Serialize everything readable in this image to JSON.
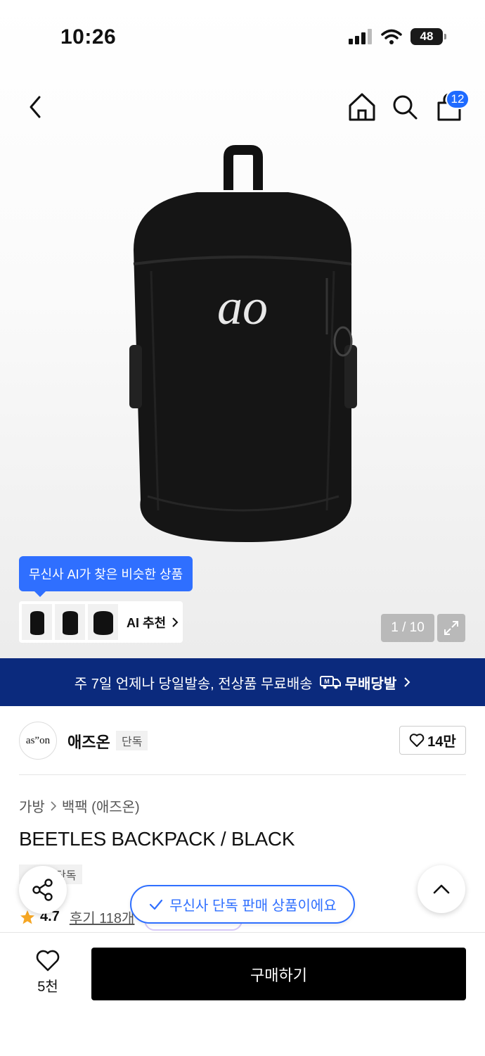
{
  "status_bar": {
    "time": "10:26",
    "battery": "48"
  },
  "nav": {
    "cart_count": "12"
  },
  "gallery": {
    "ai_tooltip": "무신사 AI가 찾은 비슷한 상품",
    "ai_label": "AI 추천",
    "counter": "1 / 10"
  },
  "banner": {
    "text": "주 7일 언제나 당일발송, 전상품 무료배송",
    "brand": "무배당발"
  },
  "brand": {
    "logo_text": "as”on",
    "name": "애즈온",
    "tag": "단독",
    "likes": "14만"
  },
  "product": {
    "breadcrumb": [
      "가방",
      "백팩 (애즈온)"
    ],
    "title": "BEETLES BACKPACK / BLACK",
    "tag": "단독",
    "rating": "4.7",
    "reviews": "후기 118개"
  },
  "toast": "무신사 단독 판매 상품이에요",
  "bottom": {
    "wish_count": "5천",
    "buy_label": "구매하기"
  },
  "colors": {
    "accent": "#2f6fff",
    "banner": "#0b2a7d",
    "star": "#f5a623"
  }
}
